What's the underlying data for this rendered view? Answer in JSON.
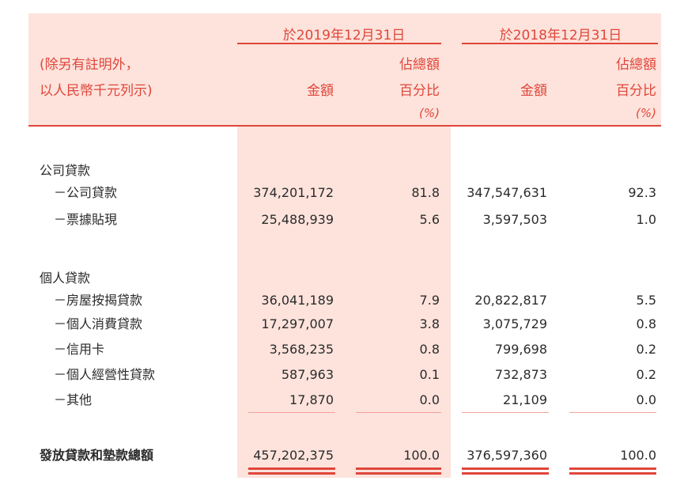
{
  "header": {
    "period_2019": "於2019年12月31日",
    "period_2018": "於2018年12月31日",
    "unit_note_line1": "(除另有註明外，",
    "unit_note_line2": "以人民幣千元列示)",
    "col_amount": "金額",
    "col_pct_line1": "佔總額",
    "col_pct_line2": "百分比",
    "col_pct_line3": "(%)"
  },
  "sections": [
    {
      "title": "公司貸款",
      "rows": [
        {
          "label": "－公司貸款",
          "amt2019": "374,201,172",
          "pct2019": "81.8",
          "amt2018": "347,547,631",
          "pct2018": "92.3"
        },
        {
          "label": "－票據貼現",
          "amt2019": "25,488,939",
          "pct2019": "5.6",
          "amt2018": "3,597,503",
          "pct2018": "1.0"
        }
      ]
    },
    {
      "title": "個人貸款",
      "rows": [
        {
          "label": "－房屋按揭貸款",
          "amt2019": "36,041,189",
          "pct2019": "7.9",
          "amt2018": "20,822,817",
          "pct2018": "5.5"
        },
        {
          "label": "－個人消費貸款",
          "amt2019": "17,297,007",
          "pct2019": "3.8",
          "amt2018": "3,075,729",
          "pct2018": "0.8"
        },
        {
          "label": "－信用卡",
          "amt2019": "3,568,235",
          "pct2019": "0.8",
          "amt2018": "799,698",
          "pct2018": "0.2"
        },
        {
          "label": "－個人經營性貸款",
          "amt2019": "587,963",
          "pct2019": "0.1",
          "amt2018": "732,873",
          "pct2018": "0.2"
        },
        {
          "label": "－其他",
          "amt2019": "17,870",
          "pct2019": "0.0",
          "amt2018": "21,109",
          "pct2018": "0.0"
        }
      ]
    }
  ],
  "total": {
    "label": "發放貸款和墊款總額",
    "amt2019": "457,202,375",
    "pct2019": "100.0",
    "amt2018": "376,597,360",
    "pct2018": "100.0"
  },
  "colors": {
    "accent": "#e0463a",
    "band": "#fde3dc"
  }
}
